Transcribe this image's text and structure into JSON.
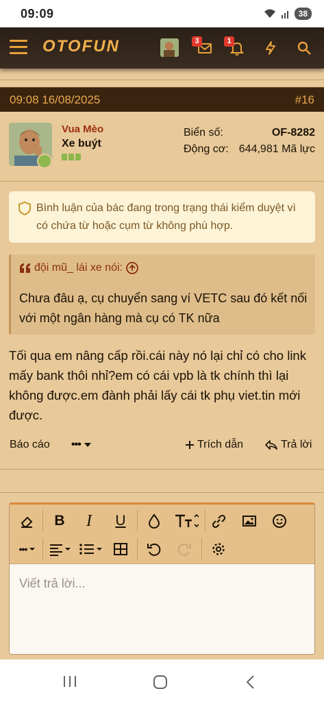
{
  "status_bar": {
    "time": "09:09",
    "battery": "38"
  },
  "nav": {
    "logo": "OTOFUN",
    "messages_badge": "3",
    "alerts_badge": "1",
    "icons": [
      "menu-icon",
      "avatar",
      "envelope-icon",
      "bell-icon",
      "lightning-icon",
      "search-icon"
    ]
  },
  "post": {
    "datetime": "09:08 16/08/2025",
    "number": "#16",
    "user": {
      "name": "Vua Mèo",
      "title": "Xe buýt",
      "plate_label": "Biển số:",
      "plate_value": "OF-8282",
      "engine_label": "Động cơ:",
      "engine_value": "644,981 Mã lực"
    },
    "notice": "Bình luận của bác đang trong trạng thái kiểm duyệt vì có chứa từ hoặc cụm từ không phù hợp.",
    "quote": {
      "author": "đội mũ_ lái xe nói:",
      "text": "Chưa đâu ạ, cụ chuyển sang ví VETC sau đó kết nối với một ngân hàng mà cụ có TK nữa"
    },
    "body": "Tối qua em nâng cấp rồi.cái này nó lại chỉ có cho link mấy bank thôi nhỉ?em có cái vpb là tk chính thì lại không được.em đành phải lấy cái tk phụ viet.tin mới được.",
    "actions": {
      "report": "Báo cáo",
      "more": "•••",
      "quote": "Trích dẫn",
      "reply": "Trả lời"
    }
  },
  "editor": {
    "placeholder": "Viết trả lời...",
    "tools_row1": [
      "eraser-icon",
      "bold-icon",
      "italic-icon",
      "underline-icon",
      "color-drop-icon",
      "text-size-icon",
      "link-icon",
      "image-icon",
      "smiley-icon"
    ],
    "tools_row2": [
      "more-icon",
      "align-icon",
      "list-icon",
      "table-icon",
      "undo-icon",
      "redo-icon",
      "settings-icon"
    ],
    "bold_glyph": "B",
    "italic_glyph": "I",
    "underline_glyph": "U",
    "more_glyph": "•••"
  },
  "accent": "#e8a23a",
  "username_color": "#9a2e0e"
}
